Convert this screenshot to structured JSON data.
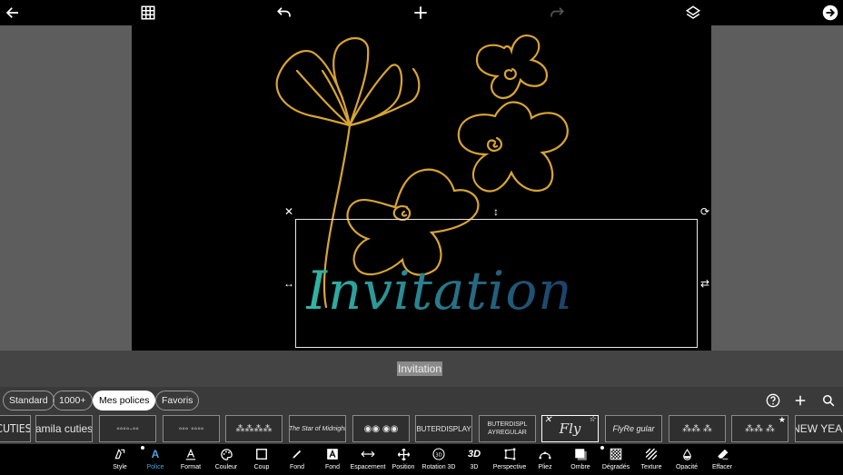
{
  "topbar": {
    "icons": [
      "back-arrow-icon",
      "grid-icon",
      "undo-icon",
      "add-icon",
      "redo-icon",
      "layers-icon",
      "next-arrow-icon"
    ]
  },
  "canvas": {
    "text_value": "Invitation",
    "gradient_colors": [
      "#2fb9a6",
      "#2a7f8e",
      "#1d3e66"
    ],
    "art_color": "#d9a531"
  },
  "text_input": {
    "value": "Invitation"
  },
  "font_filters": {
    "chips": [
      "Standard",
      "1000+",
      "Mes polices",
      "Favoris"
    ],
    "active": "Mes polices"
  },
  "font_tiles": [
    {
      "label": "CUTIES"
    },
    {
      "label": "amila cuties"
    },
    {
      "label": "◦◦◦◦·◦◦"
    },
    {
      "label": "◦◦◦ ◦◦◦◦"
    },
    {
      "label": "⁂⁂⁂⁂"
    },
    {
      "label": "The Star of Midnight"
    },
    {
      "label": "◉◉ ◉◉"
    },
    {
      "label": "BUTERDISPLAY"
    },
    {
      "label": "BUTERDISPL AYREGULAR"
    },
    {
      "label": "Fly"
    },
    {
      "label": "FlyRe gular"
    },
    {
      "label": "⁂⁂ ⁂"
    },
    {
      "label": "⁂⁂ ⁂"
    },
    {
      "label": "NEW YEAR"
    }
  ],
  "toolbar": {
    "items": [
      {
        "label": "Style",
        "icon": "style-icon"
      },
      {
        "label": "Police",
        "icon": "font-icon"
      },
      {
        "label": "Format",
        "icon": "format-icon"
      },
      {
        "label": "Couleur",
        "icon": "palette-icon"
      },
      {
        "label": "Coup",
        "icon": "stroke-icon"
      },
      {
        "label": "Fond",
        "icon": "pen-icon"
      },
      {
        "label": "Fond",
        "icon": "text-background-icon"
      },
      {
        "label": "Espacement",
        "icon": "spacing-icon"
      },
      {
        "label": "Position",
        "icon": "move-icon"
      },
      {
        "label": "Rotation 3D",
        "icon": "rotation-3d-icon"
      },
      {
        "label": "3D",
        "icon": "3d-icon"
      },
      {
        "label": "Perspective",
        "icon": "perspective-icon"
      },
      {
        "label": "Pliez",
        "icon": "bend-icon"
      },
      {
        "label": "Ombre",
        "icon": "shadow-icon"
      },
      {
        "label": "Dégradés",
        "icon": "gradient-icon"
      },
      {
        "label": "Texture",
        "icon": "texture-icon"
      },
      {
        "label": "Opacité",
        "icon": "opacity-icon"
      },
      {
        "label": "Effacer",
        "icon": "eraser-icon"
      }
    ],
    "active": "Police"
  }
}
